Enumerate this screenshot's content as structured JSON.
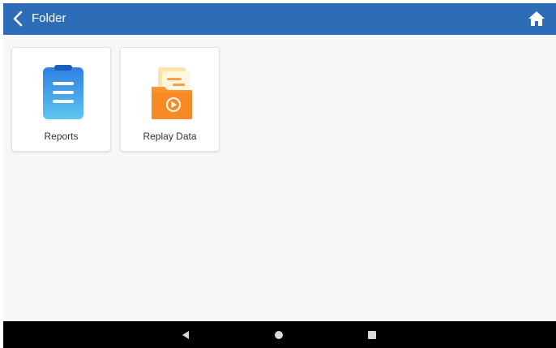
{
  "header": {
    "title": "Folder",
    "back_icon": "chevron-left-icon",
    "home_icon": "home-icon",
    "bar_color": "#2d6db7"
  },
  "folders": [
    {
      "label": "Reports",
      "icon": "clipboard-report-icon"
    },
    {
      "label": "Replay Data",
      "icon": "folder-play-icon"
    }
  ],
  "system_nav": {
    "back_icon": "triangle-back-icon",
    "home_icon": "circle-home-icon",
    "recents_icon": "square-recents-icon"
  }
}
